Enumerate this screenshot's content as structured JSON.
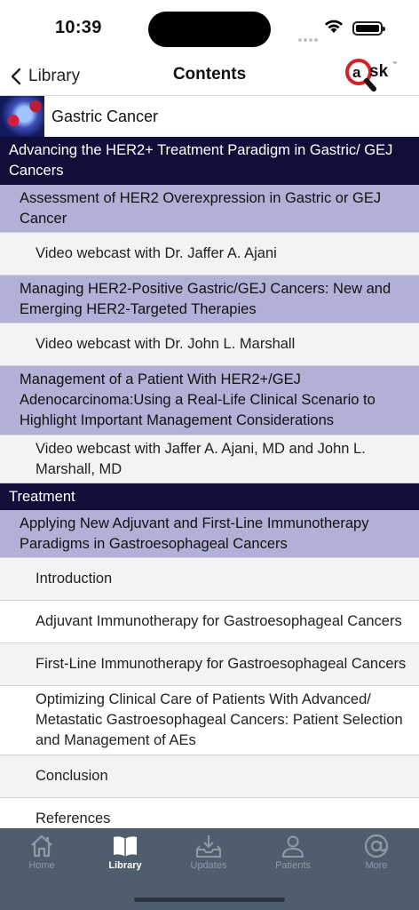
{
  "status_bar": {
    "time": "10:39"
  },
  "nav": {
    "back_label": "Library",
    "title": "Contents",
    "logo_text": "@sk"
  },
  "book": {
    "title": "Gastric Cancer"
  },
  "toc": [
    {
      "kind": "section",
      "label": "Advancing the HER2+ Treatment Paradigm in Gastric/ GEJ Cancers",
      "h": 54
    },
    {
      "kind": "topic",
      "label": "Assessment of HER2 Overexpression in Gastric or GEJ Cancer",
      "h": 54
    },
    {
      "kind": "item",
      "label": "Video webcast with Dr. Jaffer A. Ajani",
      "h": 48
    },
    {
      "kind": "topic",
      "label": "Managing HER2-Positive Gastric/GEJ Cancers: New and Emerging HER2-Targeted Therapies",
      "h": 54
    },
    {
      "kind": "item",
      "label": "Video webcast with Dr. John L. Marshall",
      "h": 48
    },
    {
      "kind": "topic",
      "label": "Management of a Patient With HER2+/GEJ Adenocarcinoma:Using a Real-Life Clinical Scenario to Highlight Important Management Considerations",
      "h": 78
    },
    {
      "kind": "item",
      "label": "Video webcast with Jaffer A. Ajani, MD and John L. Marshall, MD",
      "h": 54
    },
    {
      "kind": "section",
      "label": "Treatment",
      "h": 30
    },
    {
      "kind": "topic",
      "label": "Applying New Adjuvant and First-Line Immunotherapy Paradigms in Gastroesophageal Cancers",
      "h": 54
    },
    {
      "kind": "item",
      "label": "Introduction",
      "h": 48
    },
    {
      "kind": "item-white",
      "label": "Adjuvant Immunotherapy for Gastroesophageal Cancers",
      "h": 48
    },
    {
      "kind": "item",
      "label": "First-Line Immunotherapy for Gastroesophageal Cancers",
      "h": 48
    },
    {
      "kind": "item-white",
      "label": "Optimizing Clinical Care of Patients With Advanced/ Metastatic Gastroesophageal Cancers: Patient Selection and Management of AEs",
      "h": 78
    },
    {
      "kind": "item",
      "label": "Conclusion",
      "h": 48
    },
    {
      "kind": "item-white",
      "label": "References",
      "h": 48
    }
  ],
  "tabs": [
    {
      "label": "Home",
      "icon": "home-icon",
      "active": false
    },
    {
      "label": "Library",
      "icon": "book-icon",
      "active": true
    },
    {
      "label": "Updates",
      "icon": "download-tray-icon",
      "active": false
    },
    {
      "label": "Patients",
      "icon": "person-icon",
      "active": false
    },
    {
      "label": "More",
      "icon": "at-sign-icon",
      "active": false
    }
  ],
  "colors": {
    "section_bg": "#120e3a",
    "topic_bg": "#b3b0d8",
    "item_bg": "#f3f3f5",
    "tabbar_bg": "#4e5e6d",
    "logo_red": "#d61f26"
  }
}
